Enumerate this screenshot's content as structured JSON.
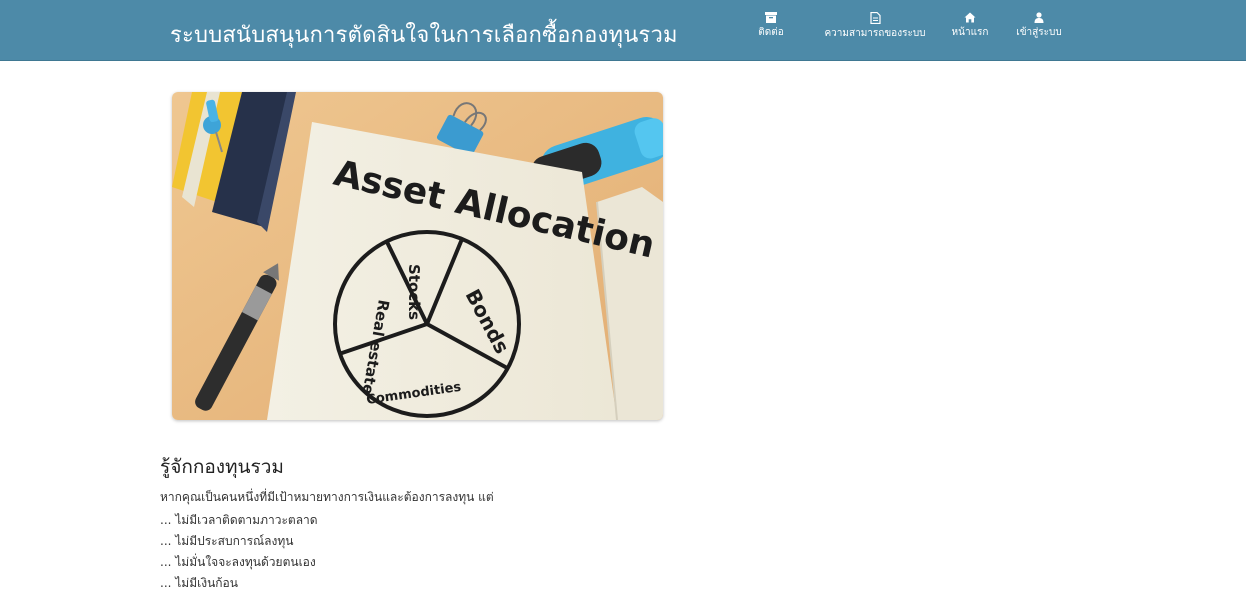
{
  "header": {
    "title": "ระบบสนับสนุนการตัดสินใจในการเลือกซื้อกองทุนรวม",
    "nav": [
      {
        "label": "ติดต่อ",
        "icon": "archive-icon"
      },
      {
        "label": "ความสามารถของระบบ",
        "icon": "document-icon"
      },
      {
        "label": "หน้าแรก",
        "icon": "home-icon"
      },
      {
        "label": "เข้าสู่ระบบ",
        "icon": "user-icon"
      }
    ],
    "bar_color": "#4d8aa8"
  },
  "hero": {
    "heading": "Asset Allocation",
    "slices": [
      "Stocks",
      "Bonds",
      "Commodities",
      "Real estate"
    ]
  },
  "about": {
    "title": "รู้จักกองทุนรวม",
    "intro": "หากคุณเป็นคนหนึ่งที่มีเป้าหมายทางการเงินและต้องการลงทุน แต่",
    "points": [
      "... ไม่มีเวลาติดตามภาวะตลาด",
      "... ไม่มีประสบการณ์ลงทุน",
      "... ไม่มั่นใจจะลงทุนด้วยตนเอง",
      "... ไม่มีเงินก้อน"
    ]
  }
}
